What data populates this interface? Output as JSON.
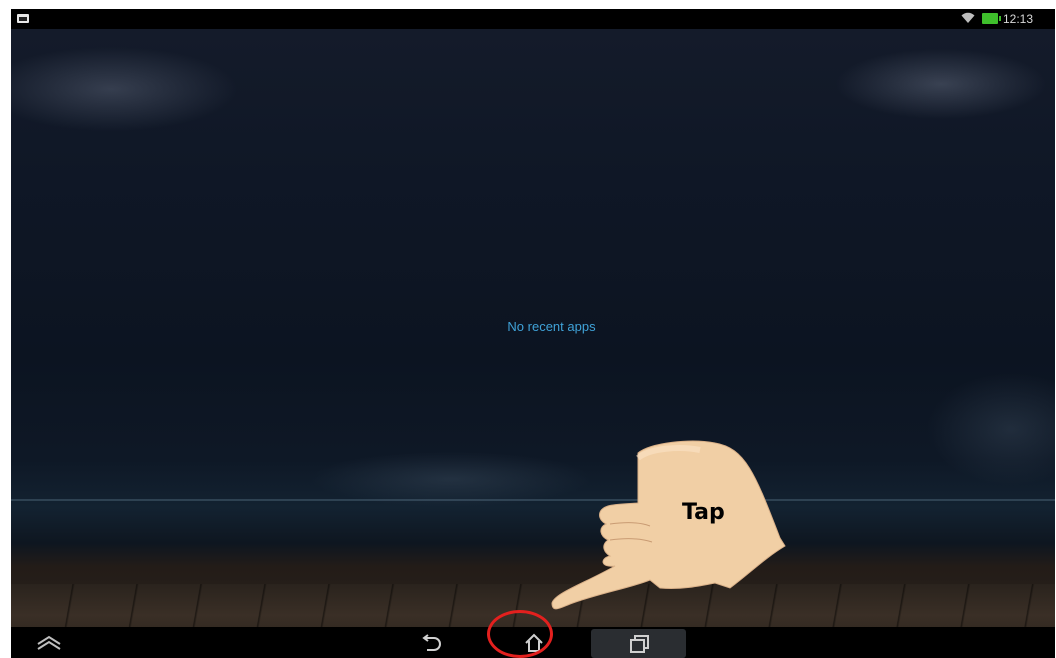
{
  "status_bar": {
    "time": "12:13",
    "icons": [
      "notification-icon",
      "wifi-icon",
      "battery-icon"
    ],
    "battery_color": "#3fbf2c"
  },
  "recent_apps": {
    "empty_message": "No recent apps",
    "message_color": "#3fa2d8"
  },
  "nav_bar": {
    "buttons": [
      "menu-icon",
      "back-icon",
      "home-icon",
      "recent-apps-icon"
    ],
    "active": "recent-apps"
  },
  "annotation": {
    "label": "Tap",
    "highlight_color": "#e3201e",
    "target": "home-button"
  }
}
